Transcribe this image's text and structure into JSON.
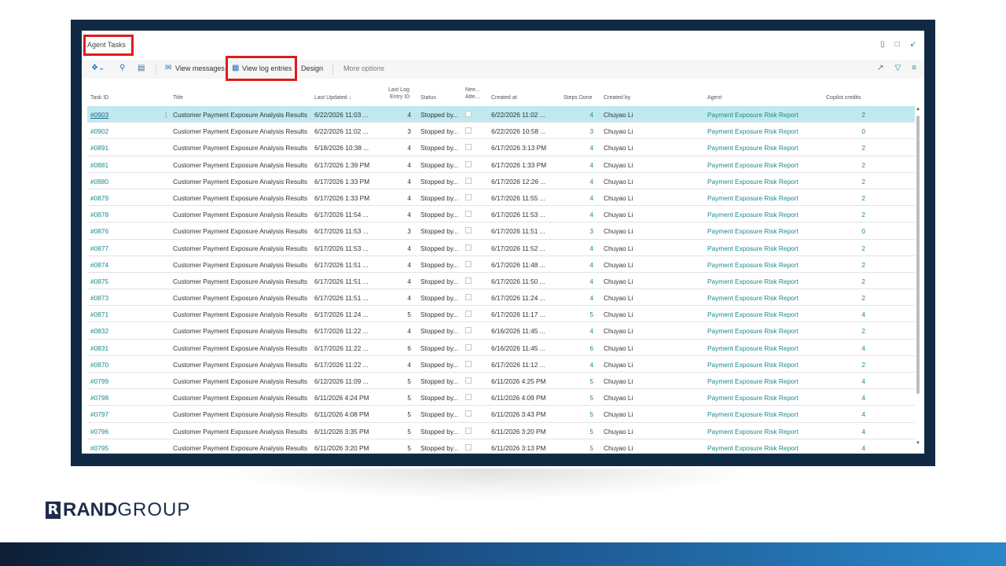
{
  "page": {
    "title": "Agent Tasks"
  },
  "toolbar": {
    "view_messages": "View messages",
    "view_log_entries": "View log entries",
    "design": "Design",
    "more_options": "More options"
  },
  "columns": {
    "task_id": "Task ID",
    "title": "Title",
    "last_updated": "Last Updated ↓",
    "last_log_entry_id_1": "Last Log",
    "last_log_entry_id_2": "Entry ID",
    "status": "Status",
    "needs_attention_1": "Nee...",
    "needs_attention_2": "Atte...",
    "created_at": "Created at",
    "steps_done": "Steps Done",
    "created_by": "Created by",
    "agent": "Agent",
    "copilot_credits": "Copilot credits"
  },
  "rows": [
    {
      "id": "#0903",
      "title": "Customer Payment Exposure Analysis Results",
      "updated": "6/22/2026 11:03 ...",
      "log": "4",
      "status": "Stopped by...",
      "created": "6/22/2026 11:02 ...",
      "steps": "4",
      "by": "Chuyao Li",
      "agent": "Payment Exposure Risk Report",
      "credits": "2"
    },
    {
      "id": "#0902",
      "title": "Customer Payment Exposure Analysis Results",
      "updated": "6/22/2026 11:02 ...",
      "log": "3",
      "status": "Stopped by...",
      "created": "6/22/2026 10:58 ...",
      "steps": "3",
      "by": "Chuyao Li",
      "agent": "Payment Exposure Risk Report",
      "credits": "0"
    },
    {
      "id": "#0891",
      "title": "Customer Payment Exposure Analysis Results",
      "updated": "6/18/2026 10:38 ...",
      "log": "4",
      "status": "Stopped by...",
      "created": "6/17/2026 3:13 PM",
      "steps": "4",
      "by": "Chuyao Li",
      "agent": "Payment Exposure Risk Report",
      "credits": "2"
    },
    {
      "id": "#0881",
      "title": "Customer Payment Exposure Analysis Results",
      "updated": "6/17/2026 1:39 PM",
      "log": "4",
      "status": "Stopped by...",
      "created": "6/17/2026 1:33 PM",
      "steps": "4",
      "by": "Chuyao Li",
      "agent": "Payment Exposure Risk Report",
      "credits": "2"
    },
    {
      "id": "#0880",
      "title": "Customer Payment Exposure Analysis Results",
      "updated": "6/17/2026 1:33 PM",
      "log": "4",
      "status": "Stopped by...",
      "created": "6/17/2026 12:26 ...",
      "steps": "4",
      "by": "Chuyao Li",
      "agent": "Payment Exposure Risk Report",
      "credits": "2"
    },
    {
      "id": "#0879",
      "title": "Customer Payment Exposure Analysis Results",
      "updated": "6/17/2026 1:33 PM",
      "log": "4",
      "status": "Stopped by...",
      "created": "6/17/2026 11:55 ...",
      "steps": "4",
      "by": "Chuyao Li",
      "agent": "Payment Exposure Risk Report",
      "credits": "2"
    },
    {
      "id": "#0878",
      "title": "Customer Payment Exposure Analysis Results",
      "updated": "6/17/2026 11:54 ...",
      "log": "4",
      "status": "Stopped by...",
      "created": "6/17/2026 11:53 ...",
      "steps": "4",
      "by": "Chuyao Li",
      "agent": "Payment Exposure Risk Report",
      "credits": "2"
    },
    {
      "id": "#0876",
      "title": "Customer Payment Exposure Analysis Results",
      "updated": "6/17/2026 11:53 ...",
      "log": "3",
      "status": "Stopped by...",
      "created": "6/17/2026 11:51 ...",
      "steps": "3",
      "by": "Chuyao Li",
      "agent": "Payment Exposure Risk Report",
      "credits": "0"
    },
    {
      "id": "#0877",
      "title": "Customer Payment Exposure Analysis Results",
      "updated": "6/17/2026 11:53 ...",
      "log": "4",
      "status": "Stopped by...",
      "created": "6/17/2026 11:52 ...",
      "steps": "4",
      "by": "Chuyao Li",
      "agent": "Payment Exposure Risk Report",
      "credits": "2"
    },
    {
      "id": "#0874",
      "title": "Customer Payment Exposure Analysis Results",
      "updated": "6/17/2026 11:51 ...",
      "log": "4",
      "status": "Stopped by...",
      "created": "6/17/2026 11:48 ...",
      "steps": "4",
      "by": "Chuyao Li",
      "agent": "Payment Exposure Risk Report",
      "credits": "2"
    },
    {
      "id": "#0875",
      "title": "Customer Payment Exposure Analysis Results",
      "updated": "6/17/2026 11:51 ...",
      "log": "4",
      "status": "Stopped by...",
      "created": "6/17/2026 11:50 ...",
      "steps": "4",
      "by": "Chuyao Li",
      "agent": "Payment Exposure Risk Report",
      "credits": "2"
    },
    {
      "id": "#0873",
      "title": "Customer Payment Exposure Analysis Results",
      "updated": "6/17/2026 11:51 ...",
      "log": "4",
      "status": "Stopped by...",
      "created": "6/17/2026 11:24 ...",
      "steps": "4",
      "by": "Chuyao Li",
      "agent": "Payment Exposure Risk Report",
      "credits": "2"
    },
    {
      "id": "#0871",
      "title": "Customer Payment Exposure Analysis Results",
      "updated": "6/17/2026 11:24 ...",
      "log": "5",
      "status": "Stopped by...",
      "created": "6/17/2026 11:17 ...",
      "steps": "5",
      "by": "Chuyao Li",
      "agent": "Payment Exposure Risk Report",
      "credits": "4"
    },
    {
      "id": "#0832",
      "title": "Customer Payment Exposure Analysis Results",
      "updated": "6/17/2026 11:22 ...",
      "log": "4",
      "status": "Stopped by...",
      "created": "6/16/2026 11:45 ...",
      "steps": "4",
      "by": "Chuyao Li",
      "agent": "Payment Exposure Risk Report",
      "credits": "2"
    },
    {
      "id": "#0831",
      "title": "Customer Payment Exposure Analysis Results",
      "updated": "6/17/2026 11:22 ...",
      "log": "6",
      "status": "Stopped by...",
      "created": "6/16/2026 11:45 ...",
      "steps": "6",
      "by": "Chuyao Li",
      "agent": "Payment Exposure Risk Report",
      "credits": "4"
    },
    {
      "id": "#0870",
      "title": "Customer Payment Exposure Analysis Results",
      "updated": "6/17/2026 11:22 ...",
      "log": "4",
      "status": "Stopped by...",
      "created": "6/17/2026 11:12 ...",
      "steps": "4",
      "by": "Chuyao Li",
      "agent": "Payment Exposure Risk Report",
      "credits": "2"
    },
    {
      "id": "#0799",
      "title": "Customer Payment Exposure Analysis Results",
      "updated": "6/12/2026 11:09 ...",
      "log": "5",
      "status": "Stopped by...",
      "created": "6/11/2026 4:25 PM",
      "steps": "5",
      "by": "Chuyao Li",
      "agent": "Payment Exposure Risk Report",
      "credits": "4"
    },
    {
      "id": "#0798",
      "title": "Customer Payment Exposure Analysis Results",
      "updated": "6/11/2026 4:24 PM",
      "log": "5",
      "status": "Stopped by...",
      "created": "6/11/2026 4:09 PM",
      "steps": "5",
      "by": "Chuyao Li",
      "agent": "Payment Exposure Risk Report",
      "credits": "4"
    },
    {
      "id": "#0797",
      "title": "Customer Payment Exposure Analysis Results",
      "updated": "6/11/2026 4:08 PM",
      "log": "5",
      "status": "Stopped by...",
      "created": "6/11/2026 3:43 PM",
      "steps": "5",
      "by": "Chuyao Li",
      "agent": "Payment Exposure Risk Report",
      "credits": "4"
    },
    {
      "id": "#0796",
      "title": "Customer Payment Exposure Analysis Results",
      "updated": "6/11/2026 3:35 PM",
      "log": "5",
      "status": "Stopped by...",
      "created": "6/11/2026 3:20 PM",
      "steps": "5",
      "by": "Chuyao Li",
      "agent": "Payment Exposure Risk Report",
      "credits": "4"
    },
    {
      "id": "#0795",
      "title": "Customer Payment Exposure Analysis Results",
      "updated": "6/11/2026 3:20 PM",
      "log": "5",
      "status": "Stopped by...",
      "created": "6/11/2026 3:13 PM",
      "steps": "5",
      "by": "Chuyao Li",
      "agent": "Payment Exposure Risk Report",
      "credits": "4"
    }
  ],
  "selected_row_index": 0,
  "logo": {
    "rand": "RAND",
    "group": "GROUP",
    "mark": "R"
  },
  "icons": {
    "copilot": "copilot-icon",
    "search": "search-icon",
    "layout": "layout-icon",
    "view_messages": "messages-icon",
    "view_log": "log-icon",
    "bookmark": "bookmark-icon",
    "open_new": "open-new-icon",
    "collapse": "collapse-icon",
    "share": "share-icon",
    "filter": "filter-icon",
    "list": "list-icon"
  },
  "colors": {
    "highlight": "#e01b1b",
    "selected_row": "#bfe9ee",
    "link": "#1c8a8a",
    "frame": "#102a43"
  }
}
